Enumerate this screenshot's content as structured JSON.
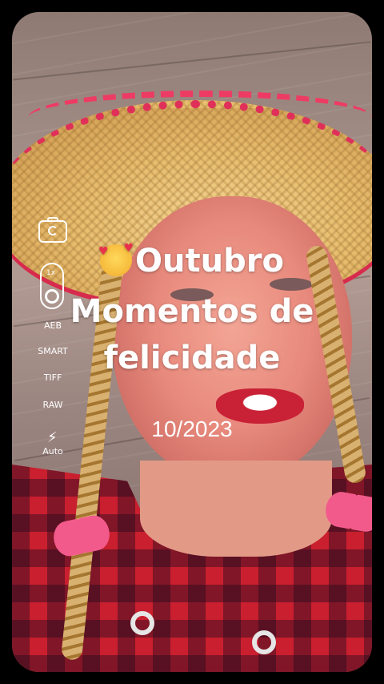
{
  "overlay": {
    "title_line1": "Outubro",
    "title_line2": "Momentos de",
    "title_line3": "felicidade",
    "date": "10/2023",
    "emoji": "smiling-face-with-hearts-icon"
  },
  "camera_controls": {
    "switch_camera_icon": "camera-switch-icon",
    "zoom_label": "1x",
    "aeb": "AEB",
    "smart": "SMART",
    "tiff": "TIFF",
    "raw": "RAW",
    "flash_icon": "flash-icon",
    "flash_mode": "Auto"
  }
}
